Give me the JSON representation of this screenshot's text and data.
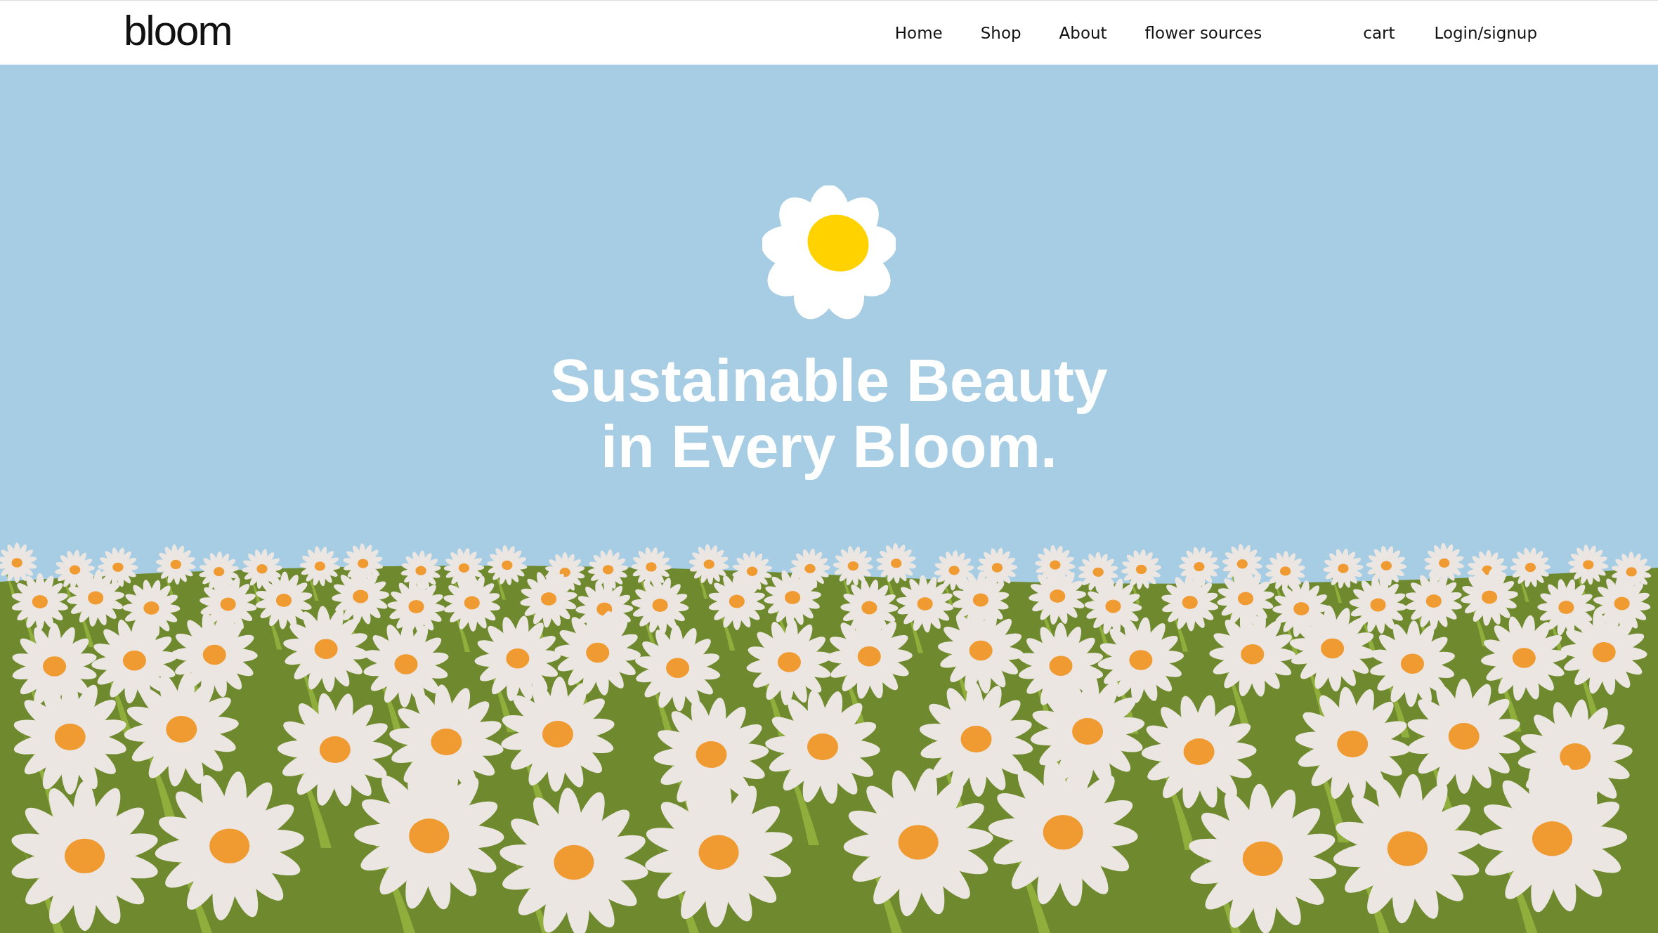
{
  "header": {
    "logo": "bloom",
    "nav": [
      "Home",
      "Shop",
      "About",
      "flower sources"
    ],
    "account": [
      "cart",
      "Login/signup"
    ]
  },
  "hero": {
    "headline": [
      "Sustainable Beauty",
      "in Every Bloom."
    ]
  }
}
